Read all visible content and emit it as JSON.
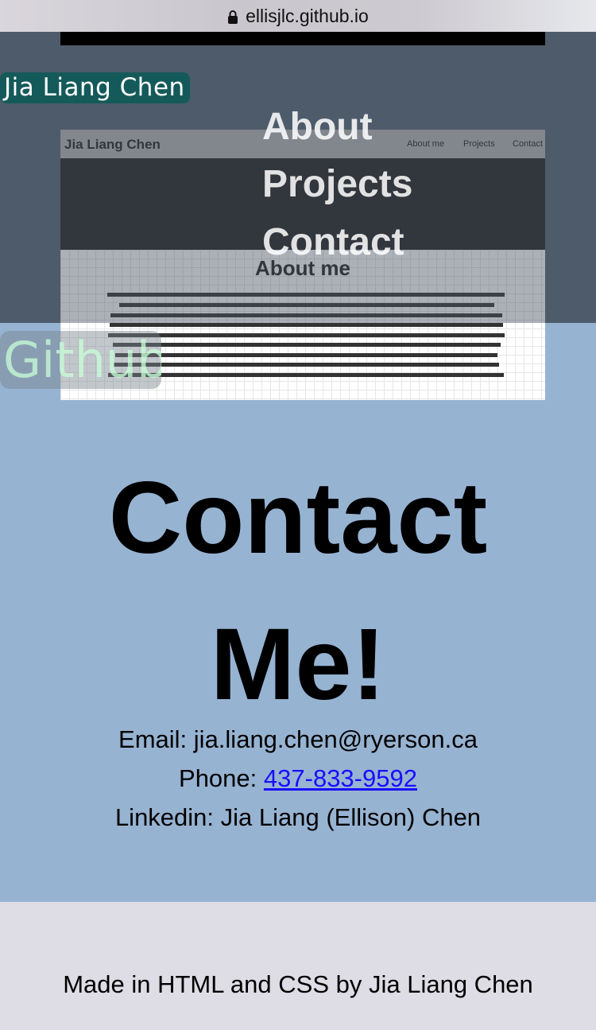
{
  "browser": {
    "url": "ellisjlc.github.io"
  },
  "header": {
    "brand": "Jia Liang Chen",
    "menu": [
      "About",
      "Projects",
      "Contact"
    ],
    "github_label": "Github"
  },
  "preview": {
    "brand": "Jia Liang Chen",
    "nav": [
      "About me",
      "Projects",
      "Contact"
    ],
    "section_title": "About me"
  },
  "contact": {
    "title_line1": "Contact",
    "title_line2": "Me!",
    "email_label": "Email:",
    "email": "jia.liang.chen@ryerson.ca",
    "phone_label": "Phone:",
    "phone": "437-833-9592",
    "linkedin_label": "Linkedin:",
    "linkedin": "Jia Liang (Ellison) Chen"
  },
  "footer": {
    "text": "Made in HTML and CSS by Jia Liang Chen"
  }
}
